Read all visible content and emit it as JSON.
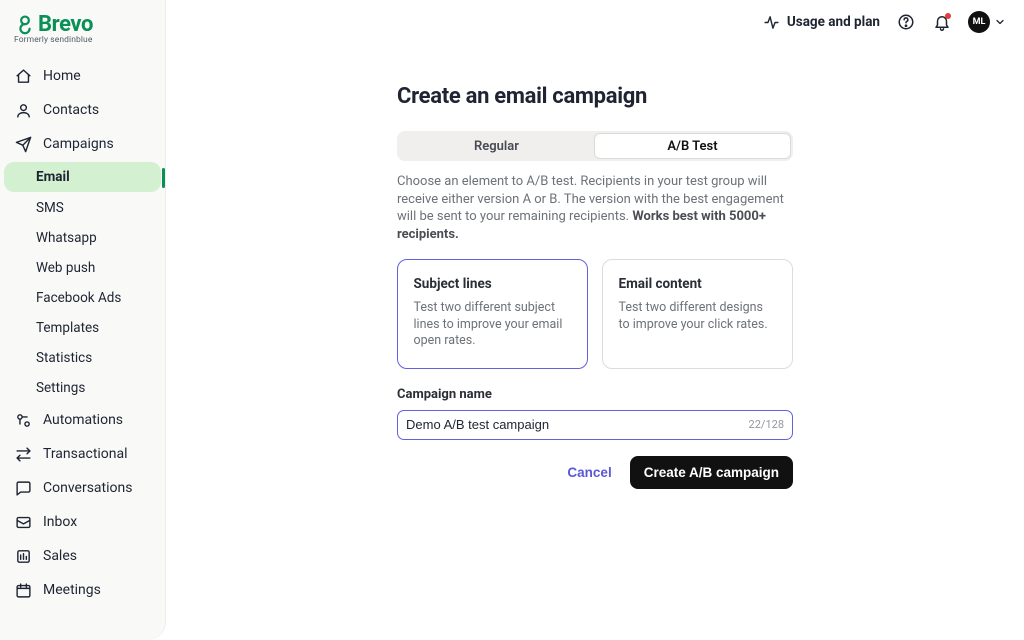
{
  "brand": {
    "name": "Brevo",
    "sub": "Formerly sendinblue"
  },
  "sidebar": {
    "items": [
      {
        "label": "Home"
      },
      {
        "label": "Contacts"
      },
      {
        "label": "Campaigns"
      },
      {
        "label": "Automations"
      },
      {
        "label": "Transactional"
      },
      {
        "label": "Conversations"
      },
      {
        "label": "Inbox"
      },
      {
        "label": "Sales"
      },
      {
        "label": "Meetings"
      }
    ],
    "campaign_sub": [
      {
        "label": "Email",
        "active": true
      },
      {
        "label": "SMS"
      },
      {
        "label": "Whatsapp"
      },
      {
        "label": "Web push"
      },
      {
        "label": "Facebook Ads"
      },
      {
        "label": "Templates"
      },
      {
        "label": "Statistics"
      },
      {
        "label": "Settings"
      }
    ]
  },
  "topbar": {
    "usage_label": "Usage and plan",
    "avatar_initials": "ML"
  },
  "page": {
    "title": "Create an email campaign",
    "tabs": {
      "regular": "Regular",
      "ab": "A/B Test",
      "active": "ab"
    },
    "ab_desc_pre": "Choose an element to A/B test. Recipients in your test group will receive either version A or B. The version with the best engagement will be sent to your remaining recipients. ",
    "ab_desc_bold": "Works best with 5000+ recipients.",
    "cards": {
      "subject": {
        "title": "Subject lines",
        "desc": "Test two different subject lines to improve your email open rates."
      },
      "content": {
        "title": "Email content",
        "desc": "Test two different designs to improve your click rates."
      },
      "selected": "subject"
    },
    "field_label": "Campaign name",
    "field_value": "Demo A/B test campaign",
    "counter": "22/128",
    "cancel_label": "Cancel",
    "submit_label": "Create A/B campaign"
  }
}
